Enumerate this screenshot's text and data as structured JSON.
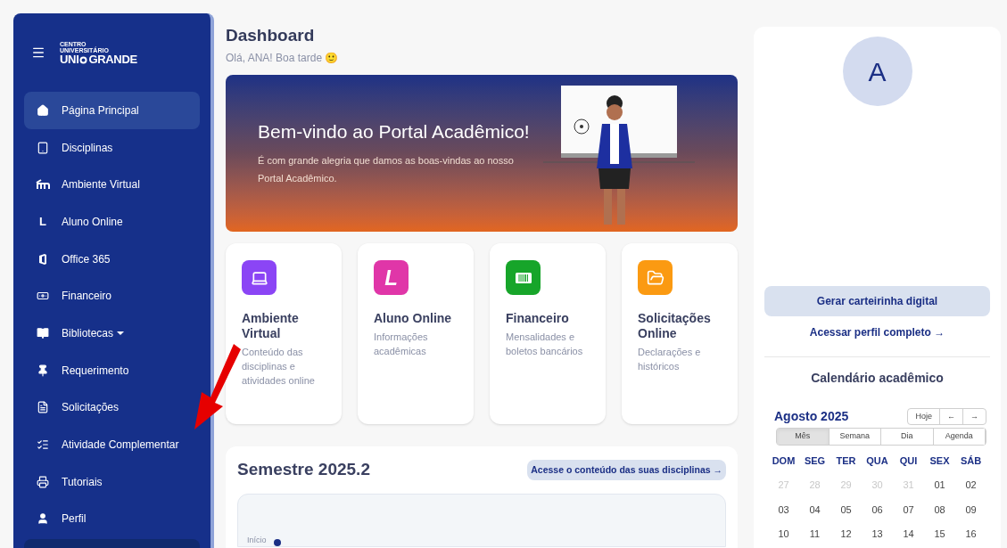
{
  "logo": {
    "line1": "CENTRO",
    "line2": "UNIVERSITÁRIO",
    "wordmark_left": "UNI",
    "wordmark_right": "GRANDE"
  },
  "sidebar": {
    "items": [
      {
        "label": "Página Principal",
        "kind": "home",
        "selected": true
      },
      {
        "label": "Disciplinas",
        "kind": "tablet",
        "selected": false
      },
      {
        "label": "Ambiente Virtual",
        "kind": "moodle",
        "selected": false
      },
      {
        "label": "Aluno Online",
        "kind": "letter",
        "glyph": "L",
        "selected": false
      },
      {
        "label": "Office 365",
        "kind": "office",
        "selected": false
      },
      {
        "label": "Financeiro",
        "kind": "money",
        "selected": false
      },
      {
        "label": "Bibliotecas",
        "kind": "book",
        "selected": false,
        "dropdown": true
      },
      {
        "label": "Requerimento",
        "kind": "pin",
        "selected": false
      },
      {
        "label": "Solicitações",
        "kind": "file",
        "selected": false
      },
      {
        "label": "Atividade Complementar",
        "kind": "list",
        "selected": false
      },
      {
        "label": "Tutoriais",
        "kind": "printer",
        "selected": false
      },
      {
        "label": "Perfil",
        "kind": "user",
        "selected": false
      }
    ]
  },
  "header": {
    "title": "Dashboard",
    "greeting": "Olá, ANA! Boa tarde",
    "emoji": "🙂"
  },
  "banner": {
    "title": "Bem-vindo ao Portal Acadêmico!",
    "text": "É com grande alegria que damos as boas-vindas ao nosso Portal Acadêmico."
  },
  "cards": [
    {
      "title": "Ambiente Virtual",
      "text": "Conteúdo das disciplinas e atividades online",
      "kind": "laptop",
      "color": "#8b45f5"
    },
    {
      "title": "Aluno Online",
      "text": "Informações acadêmicas",
      "kind": "letter",
      "glyph": "L",
      "color": "#e036a8"
    },
    {
      "title": "Financeiro",
      "text": "Mensalidades e boletos bancários",
      "kind": "barcode",
      "color": "#17a52a"
    },
    {
      "title": "Solicitações Online",
      "text": "Declarações e históricos",
      "kind": "folder",
      "color": "#fb9a12"
    }
  ],
  "semester": {
    "title": "Semestre 2025.2",
    "link": "Acesse o conteúdo das suas disciplinas →",
    "timeline_label": "Início"
  },
  "profile": {
    "initial": "A",
    "button": "Gerar carteirinha digital",
    "link": "Acessar perfil completo →"
  },
  "calendar": {
    "title": "Calendário acadêmico",
    "month": "Agosto 2025",
    "today": "Hoje",
    "prev": "←",
    "next": "→",
    "views": [
      {
        "label": "Mês",
        "selected": true
      },
      {
        "label": "Semana",
        "selected": false
      },
      {
        "label": "Dia",
        "selected": false
      },
      {
        "label": "Agenda",
        "selected": false
      }
    ],
    "weekdays": [
      "DOM",
      "SEG",
      "TER",
      "QUA",
      "QUI",
      "SEX",
      "SÁB"
    ],
    "weeks": [
      [
        {
          "day": "27",
          "muted": true
        },
        {
          "day": "28",
          "muted": true
        },
        {
          "day": "29",
          "muted": true
        },
        {
          "day": "30",
          "muted": true
        },
        {
          "day": "31",
          "muted": true
        },
        {
          "day": "01",
          "muted": false
        },
        {
          "day": "02",
          "muted": false
        }
      ],
      [
        {
          "day": "03",
          "muted": false
        },
        {
          "day": "04",
          "muted": false
        },
        {
          "day": "05",
          "muted": false
        },
        {
          "day": "06",
          "muted": false
        },
        {
          "day": "07",
          "muted": false
        },
        {
          "day": "08",
          "muted": false
        },
        {
          "day": "09",
          "muted": false
        }
      ],
      [
        {
          "day": "10",
          "muted": false
        },
        {
          "day": "11",
          "muted": false
        },
        {
          "day": "12",
          "muted": false
        },
        {
          "day": "13",
          "muted": false
        },
        {
          "day": "14",
          "muted": false
        },
        {
          "day": "15",
          "muted": false
        },
        {
          "day": "16",
          "muted": false
        }
      ]
    ]
  }
}
